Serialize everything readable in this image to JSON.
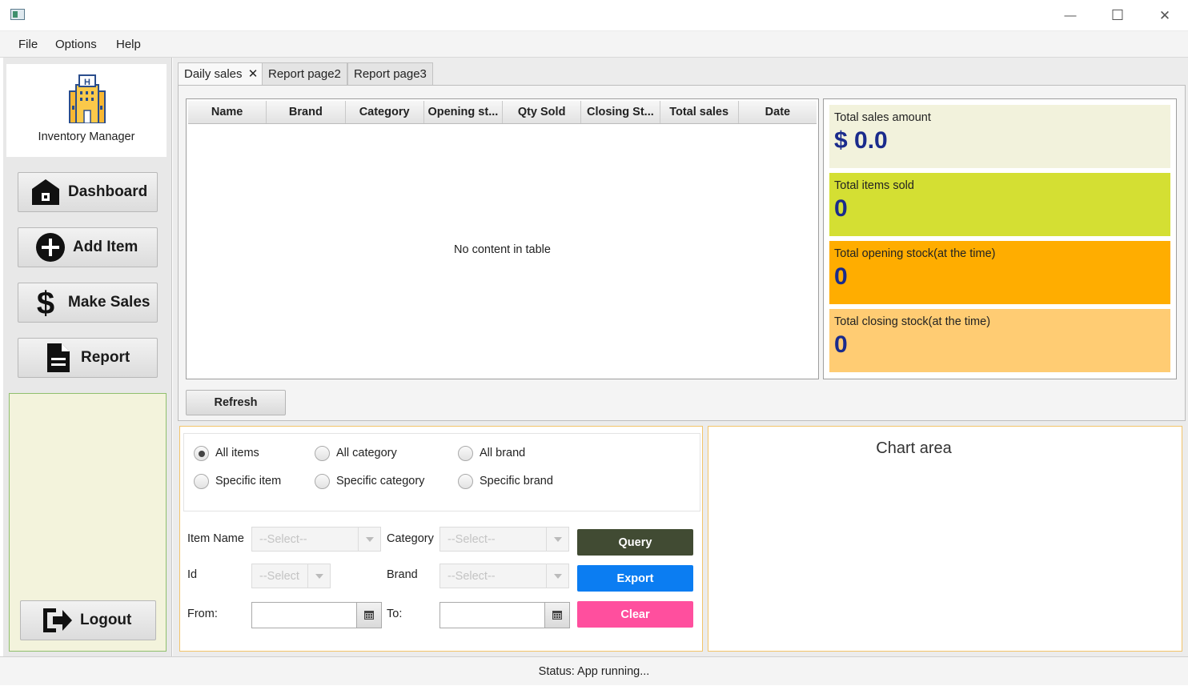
{
  "window": {
    "minimize": "—",
    "maximize": "☐",
    "close": "✕"
  },
  "menu": [
    "File",
    "Options",
    "Help"
  ],
  "sidebar": {
    "app_name": "Inventory Manager",
    "nav": [
      {
        "label": "Dashboard",
        "icon": "home-icon"
      },
      {
        "label": "Add Item",
        "icon": "plus-circle-icon"
      },
      {
        "label": "Make Sales",
        "icon": "dollar-icon"
      },
      {
        "label": "Report",
        "icon": "document-icon"
      }
    ],
    "logout": "Logout"
  },
  "tabs": [
    {
      "label": "Daily sales",
      "active": true,
      "closable": true
    },
    {
      "label": "Report page2",
      "active": false
    },
    {
      "label": "Report page3",
      "active": false
    }
  ],
  "table": {
    "columns": [
      "Name",
      "Brand",
      "Category",
      "Opening st...",
      "Qty Sold",
      "Closing St...",
      "Total sales",
      "Date"
    ],
    "rows": [],
    "empty_message": "No content in table"
  },
  "refresh": "Refresh",
  "stats": [
    {
      "label": "Total sales amount",
      "value": "$ 0.0",
      "color": "#f2f2dc"
    },
    {
      "label": "Total items sold",
      "value": "0",
      "color": "#d4df33"
    },
    {
      "label": "Total opening stock(at the time)",
      "value": "0",
      "color": "#ffad00"
    },
    {
      "label": "Total closing stock(at the time)",
      "value": "0",
      "color": "#ffcc73"
    }
  ],
  "filters": {
    "radios": [
      {
        "label": "All items",
        "checked": true
      },
      {
        "label": "All category",
        "checked": false
      },
      {
        "label": "All brand",
        "checked": false
      },
      {
        "label": "Specific item",
        "checked": false
      },
      {
        "label": "Specific category",
        "checked": false
      },
      {
        "label": "Specific brand",
        "checked": false
      }
    ],
    "item_name_label": "Item Name",
    "item_name_value": "--Select--",
    "category_label": "Category",
    "category_value": "--Select--",
    "id_label": "Id",
    "id_value": "--Select",
    "brand_label": "Brand",
    "brand_value": "--Select--",
    "from_label": "From:",
    "to_label": "To:"
  },
  "actions": {
    "query": "Query",
    "export": "Export",
    "clear": "Clear",
    "query_color": "#414b33",
    "export_color": "#0b7df2",
    "clear_color": "#ff4f9e"
  },
  "chart_title": "Chart area",
  "status": "Status: App running..."
}
